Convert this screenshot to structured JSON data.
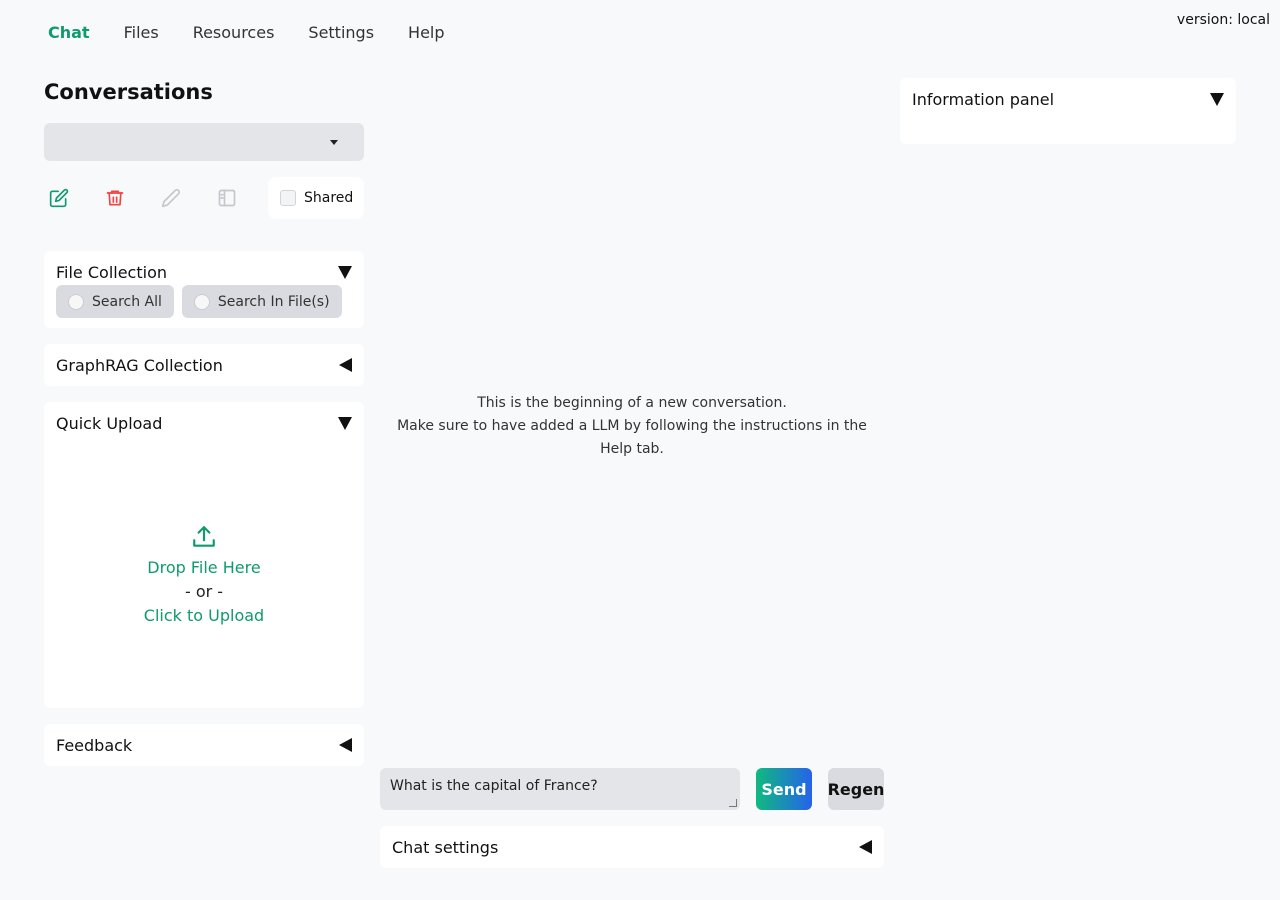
{
  "version": "version: local",
  "nav": {
    "tabs": [
      {
        "label": "Chat",
        "active": true
      },
      {
        "label": "Files"
      },
      {
        "label": "Resources"
      },
      {
        "label": "Settings"
      },
      {
        "label": "Help"
      }
    ]
  },
  "sidebar": {
    "conversations_title": "Conversations",
    "conversation_select_value": "",
    "toolbar": {
      "icons": [
        "new-chat-icon",
        "delete-icon",
        "rename-icon",
        "sidebar-toggle-icon"
      ],
      "shared_label": "Shared"
    },
    "file_collection": {
      "title": "File Collection",
      "options": [
        "Search All",
        "Search In File(s)"
      ]
    },
    "graphrag_collection": {
      "title": "GraphRAG Collection"
    },
    "quick_upload": {
      "title": "Quick Upload",
      "drop_text": "Drop File Here",
      "or_text": "- or -",
      "click_text": "Click to Upload"
    },
    "feedback": {
      "title": "Feedback"
    }
  },
  "chat": {
    "empty_line1": "This is the beginning of a new conversation.",
    "empty_line2": "Make sure to have added a LLM by following the instructions in the Help tab.",
    "input_value": "What is the capital of France?",
    "send_label": "Send",
    "regen_label": "Regen",
    "settings_title": "Chat settings"
  },
  "info_panel": {
    "title": "Information panel"
  },
  "colors": {
    "accent": "#0f9b6c",
    "danger": "#ef4444",
    "muted_icon": "#c4c7cc"
  }
}
